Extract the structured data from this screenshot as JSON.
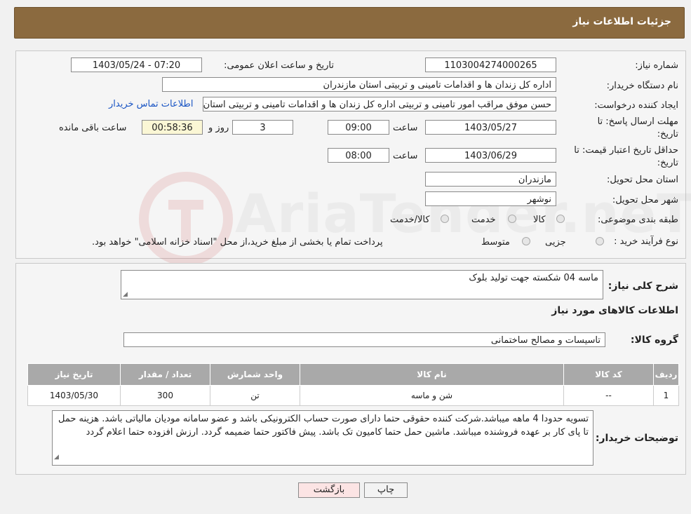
{
  "header": {
    "title": "جزئیات اطلاعات نیاز"
  },
  "form": {
    "need_number_label": "شماره نیاز:",
    "need_number": "1103004274000265",
    "announce_label": "تاریخ و ساعت اعلان عمومی:",
    "announce_value": "1403/05/24 - 07:20",
    "buyer_org_label": "نام دستگاه خریدار:",
    "buyer_org": "اداره کل زندان ها و اقدامات تامینی و تربیتی استان مازندران",
    "requester_label": "ایجاد کننده درخواست:",
    "requester": "حسن موفق مراقب امور تامینی و تربیتی اداره کل زندان ها و اقدامات تامینی و تربیتی استان مازندران",
    "contact_link": "اطلاعات تماس خریدار",
    "reply_deadline_label_1": "مهلت ارسال پاسخ: تا",
    "reply_deadline_label_2": "تاریخ:",
    "reply_date": "1403/05/27",
    "time_label": "ساعت",
    "reply_time": "09:00",
    "days_value": "3",
    "days_label": "روز و",
    "remaining_time": "00:58:36",
    "remaining_label": "ساعت باقی مانده",
    "validity_label_1": "حداقل تاریخ اعتبار قیمت: تا",
    "validity_label_2": "تاریخ:",
    "validity_date": "1403/06/29",
    "validity_time": "08:00",
    "province_label": "استان محل تحویل:",
    "province": "مازندران",
    "city_label": "شهر محل تحویل:",
    "city": "نوشهر",
    "category_label": "طبقه بندی موضوعی:",
    "category_options": [
      "کالا",
      "خدمت",
      "کالا/خدمت"
    ],
    "process_label": "نوع فرآیند خرید :",
    "process_options": [
      "جزیی",
      "متوسط"
    ],
    "process_note": "پرداخت تمام یا بخشی از مبلغ خرید،از محل \"اسناد خزانه اسلامی\" خواهد بود."
  },
  "details": {
    "summary_label": "شرح کلی نیاز:",
    "summary": "ماسه 04 شکسته جهت تولید بلوک",
    "goods_info_title": "اطلاعات کالاهای مورد نیاز",
    "goods_group_label": "گروه کالا:",
    "goods_group": "تاسیسات و مصالح ساختمانی",
    "table": {
      "headers": [
        "ردیف",
        "کد کالا",
        "نام کالا",
        "واحد شمارش",
        "تعداد / مقدار",
        "تاریخ نیاز"
      ],
      "rows": [
        [
          "1",
          "--",
          "شن و ماسه",
          "تن",
          "300",
          "1403/05/30"
        ]
      ]
    },
    "buyer_notes_label": "توضیحات خریدار:",
    "buyer_notes": "تسویه حدودا 4 ماهه میباشد.شرکت کننده حقوقی حتما دارای صورت حساب الکترونیکی باشد و عضو سامانه مودیان مالیاتی باشد. هزینه حمل تا پای کار بر عهده فروشنده میباشد. ماشین حمل حتما کامیون تک باشد. پیش فاکتور حتما ضمیمه گردد. ارزش افزوده حتما اعلام گردد"
  },
  "buttons": {
    "print": "چاپ",
    "back": "بازگشت"
  },
  "watermark": {
    "text": "AriaTender.neT"
  }
}
